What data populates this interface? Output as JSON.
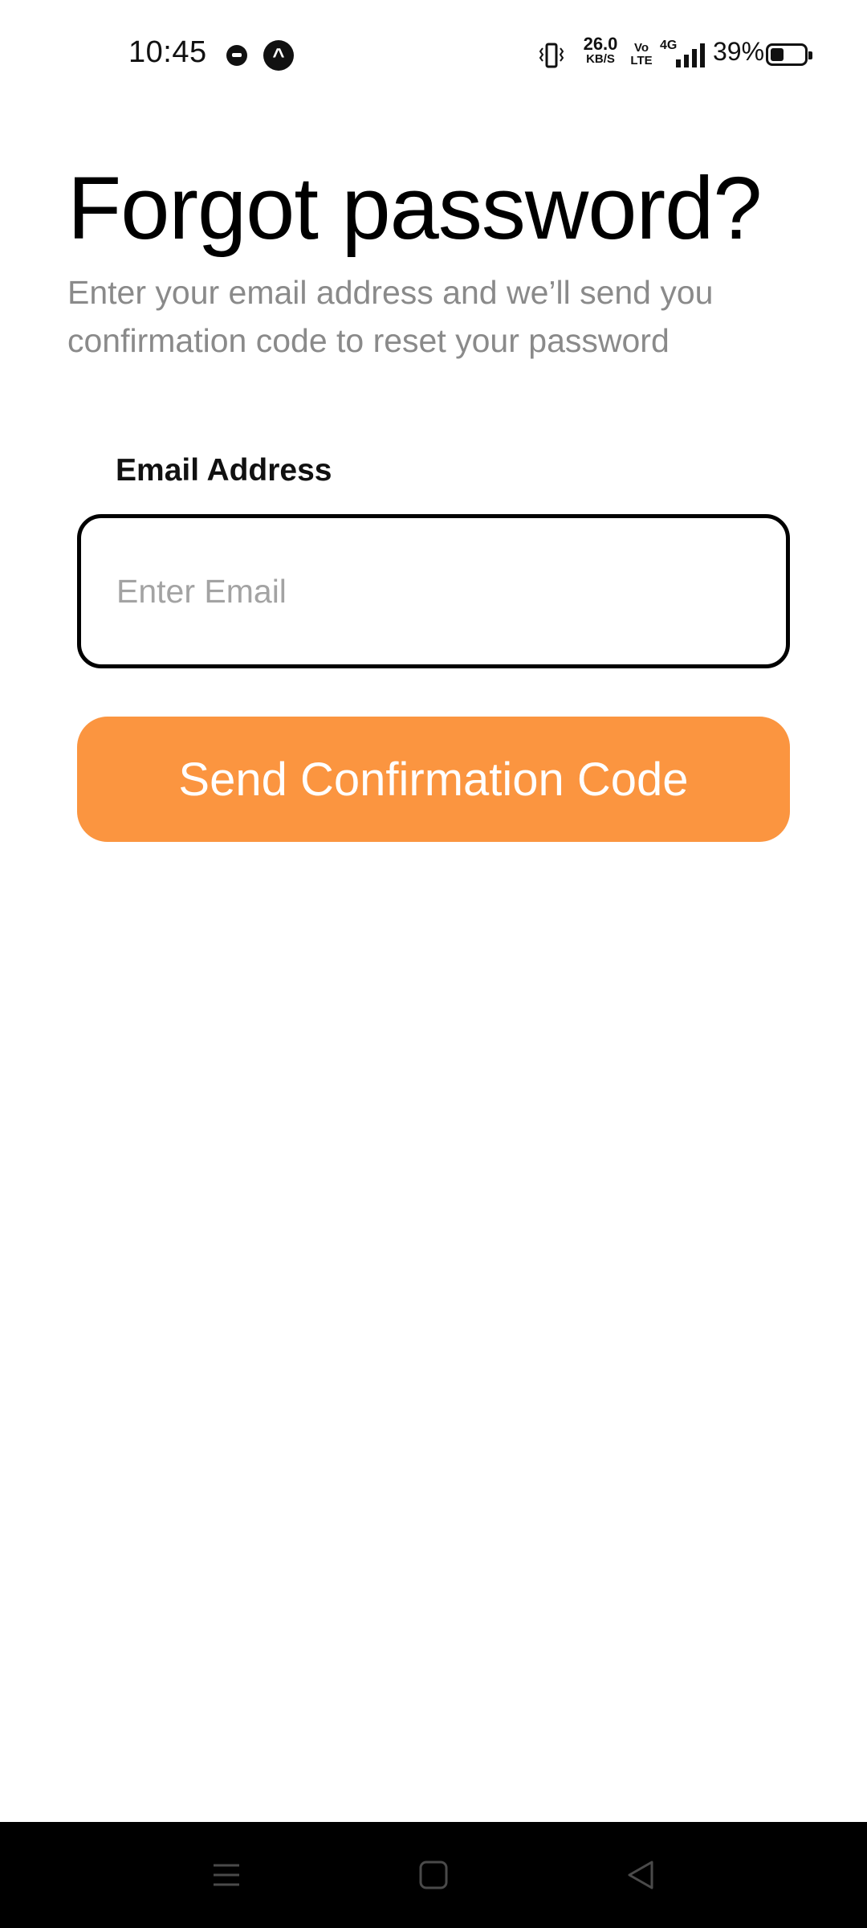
{
  "status_bar": {
    "time": "10:45",
    "net_speed_value": "26.0",
    "net_speed_unit": "KB/S",
    "volte_top": "Vo",
    "volte_bottom": "LTE",
    "network_type": "4G",
    "battery_percent": "39%",
    "battery_level": 0.39,
    "icons": [
      "notification-icon",
      "app-icon",
      "vibrate-icon",
      "signal-icon",
      "battery-icon"
    ]
  },
  "main": {
    "title": "Forgot password?",
    "subtitle": "Enter your email address and we’ll send you confirmation code to reset your password",
    "email_label": "Email Address",
    "email_placeholder": "Enter Email",
    "email_value": "",
    "submit_label": "Send Confirmation Code"
  },
  "nav_bar": {
    "icons": [
      "menu-icon",
      "home-icon",
      "back-icon"
    ]
  },
  "colors": {
    "accent": "#fb9540",
    "subtitle_text": "#8a8a8a",
    "background": "#ffffff",
    "nav_bar": "#000000"
  }
}
